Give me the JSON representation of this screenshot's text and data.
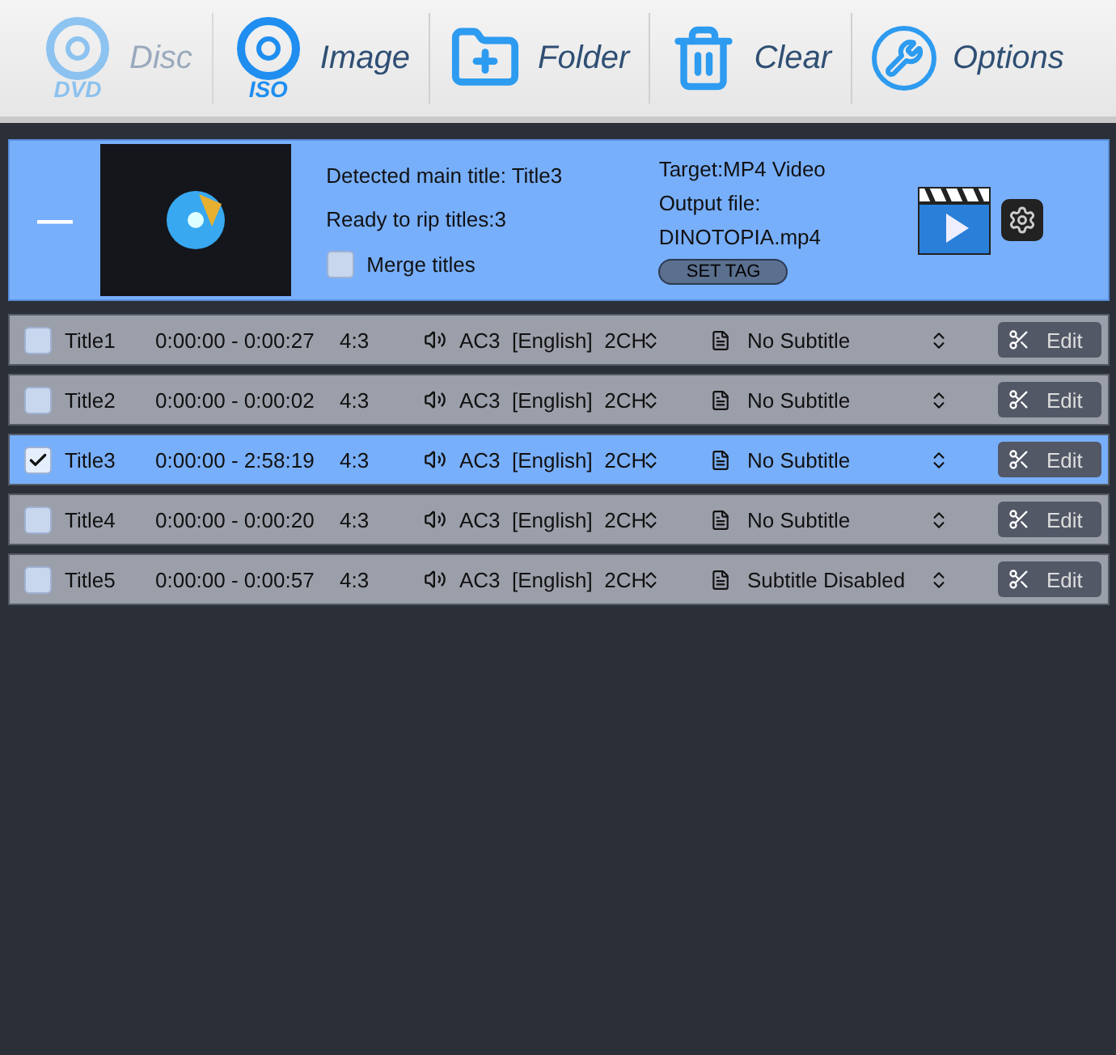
{
  "toolbar": [
    {
      "kind": "dvd",
      "label": "Disc",
      "icon_text": "DVD",
      "disabled": true
    },
    {
      "kind": "iso",
      "label": "Image",
      "icon_text": "ISO",
      "disabled": false
    },
    {
      "kind": "folder",
      "label": "Folder",
      "disabled": false
    },
    {
      "kind": "clear",
      "label": "Clear",
      "disabled": false
    },
    {
      "kind": "options",
      "label": "Options",
      "disabled": false
    }
  ],
  "source": {
    "collapse_symbol": "—",
    "detected": "Detected main title: Title3",
    "ready": "Ready to rip titles:3",
    "merge": {
      "label": "Merge titles",
      "checked": false
    },
    "target": "Target:MP4 Video",
    "output_label": "Output file:",
    "output_file": "DINOTOPIA.mp4",
    "set_tag": "SET TAG"
  },
  "titles": [
    {
      "name": "Title1",
      "range": "0:00:00 - 0:00:27",
      "aspect": "4:3",
      "audio": "AC3  [English]  2CH",
      "subtitle": "No Subtitle",
      "edit": "Edit",
      "checked": false,
      "selected": false
    },
    {
      "name": "Title2",
      "range": "0:00:00 - 0:00:02",
      "aspect": "4:3",
      "audio": "AC3  [English]  2CH",
      "subtitle": "No Subtitle",
      "edit": "Edit",
      "checked": false,
      "selected": false
    },
    {
      "name": "Title3",
      "range": "0:00:00 - 2:58:19",
      "aspect": "4:3",
      "audio": "AC3  [English]  2CH",
      "subtitle": "No Subtitle",
      "edit": "Edit",
      "checked": true,
      "selected": true
    },
    {
      "name": "Title4",
      "range": "0:00:00 - 0:00:20",
      "aspect": "4:3",
      "audio": "AC3  [English]  2CH",
      "subtitle": "No Subtitle",
      "edit": "Edit",
      "checked": false,
      "selected": false
    },
    {
      "name": "Title5",
      "range": "0:00:00 - 0:00:57",
      "aspect": "4:3",
      "audio": "AC3  [English]  2CH",
      "subtitle": "Subtitle Disabled",
      "edit": "Edit",
      "checked": false,
      "selected": false
    }
  ]
}
